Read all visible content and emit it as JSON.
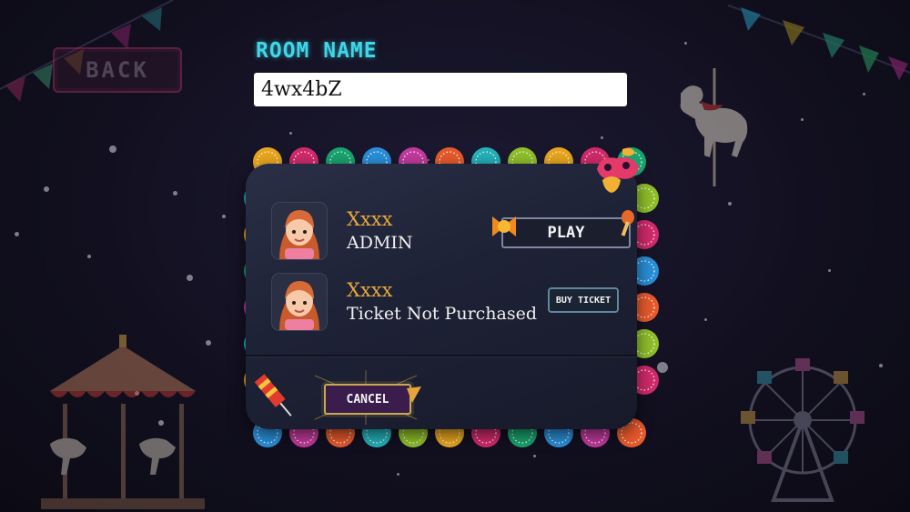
{
  "back_button": {
    "label": "BACK"
  },
  "room": {
    "label": "ROOM NAME",
    "value": "4wx4bZ"
  },
  "players": [
    {
      "name": "Xxxx",
      "status": "ADMIN",
      "action": "PLAY"
    },
    {
      "name": "Xxxx",
      "status": "Ticket Not Purchased",
      "action": "BUY TICKET"
    }
  ],
  "cancel_button": {
    "label": "CANCEL"
  },
  "colors": {
    "accent_cyan": "#3fd6e8",
    "name_gold": "#e8a83a",
    "panel": "#1e2236"
  }
}
